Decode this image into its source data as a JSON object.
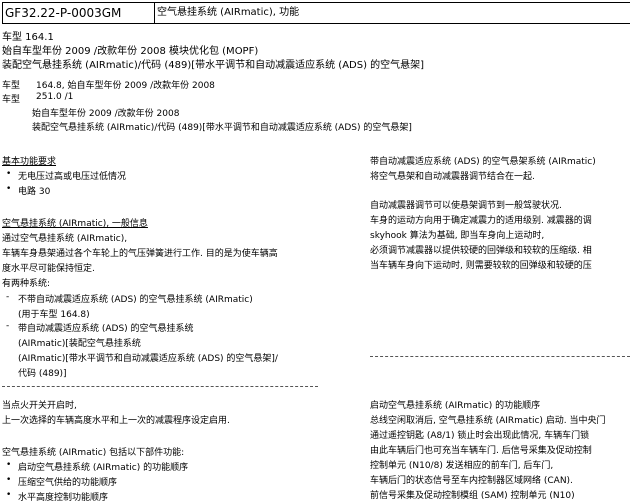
{
  "header": {
    "code": "GF32.22-P-0003GM",
    "title": "空气悬挂系统 (AIRmatic), 功能"
  },
  "vehicle": {
    "model_line": "车型   164.1",
    "model_year_line": "始自车型年份 2009 /改款年份 2008 模块优化包 (MOPF)",
    "equipment_line": "装配空气悬挂系统 (AIRmatic)/代码 (489)[带水平调节和自动减震适应系统 (ADS) 的空气悬架]",
    "model2_label": "车型",
    "model2_value": "164.8, 始自车型年份 2009 /改款年份 2008",
    "model3_label": "车型",
    "model3_value": "251.0 /1",
    "model3_year": "始自车型年份 2009 /改款年份 2008",
    "model3_equipment": "装配空气悬挂系统 (AIRmatic)/代码 (489)[带水平调节和自动减震适应系统 (ADS) 的空气悬架]"
  },
  "left": {
    "basic_title": "基本功能要求",
    "basic_items": [
      "无电压过高或电压过低情况",
      "电路 30"
    ],
    "general_title": "空气悬挂系统 (AIRmatic), 一般信息",
    "general_lines": [
      "通过空气悬挂系统 (AIRmatic),",
      "车辆车身悬架通过各个车轮上的气压弹簧进行工作. 目的是为使车辆高",
      "度水平尽可能保持恒定."
    ],
    "two_systems": "有两种系统:",
    "sys1_lines": [
      "不带自动减震适应系统 (ADS) 的空气悬挂系统 (AIRmatic)",
      "(用于车型 164.8)"
    ],
    "sys2_lines": [
      "带自动减震适应系统 (ADS) 的空气悬挂系统",
      "(AIRmatic)[装配空气悬挂系统",
      "(AIRmatic)[带水平调节和自动减震适应系统 (ADS) 的空气悬架]/",
      "代码 (489)]"
    ],
    "ignition_lines": [
      "当点火开关开启时,",
      "上一次选择的车辆高度水平和上一次的减震程序设定启用."
    ],
    "components_title": "空气悬挂系统 (AIRmatic) 包括以下部件功能:",
    "components": [
      "启动空气悬挂系统 (AIRmatic) 的功能顺序",
      "压缩空气供给的功能顺序",
      "水平高度控制功能顺序"
    ]
  },
  "right": {
    "ads_lines": [
      "带自动减震适应系统 (ADS) 的空气悬架系统 (AIRmatic)",
      "将空气悬架和自动减震器调节结合在一起."
    ],
    "damper_lines": [
      "自动减震器调节可以使悬架调节到一般驾驶状况.",
      "车身的运动方向用于确定减震力的适用级别. 减震器的调",
      "skyhook 算法为基础, 即当车身向上运动时,",
      "必须调节减震器以提供较硬的回弹级和较软的压缩级. 相",
      "当车辆车身向下运动时, 则需要较软的回弹级和较硬的压"
    ],
    "activation_lines": [
      "启动空气悬挂系统 (AIRmatic) 的功能顺序",
      "总线空闲取消后, 空气悬挂系统 (AIRmatic) 启动. 当中央门",
      "通过遥控钥匙 (A8/1) 锁止时会出现此情况, 车辆车门锁",
      "由此车辆后门也可充当车辆车门. 后信号采集及促动控制",
      "控制单元 (N10/8) 发送相应的前车门, 后车门,",
      "车辆后门的状态信号至车内控制器区域网络 (CAN).",
      "前信号采集及促动控制模组 (SAM) 控制单元 (N10)"
    ]
  }
}
